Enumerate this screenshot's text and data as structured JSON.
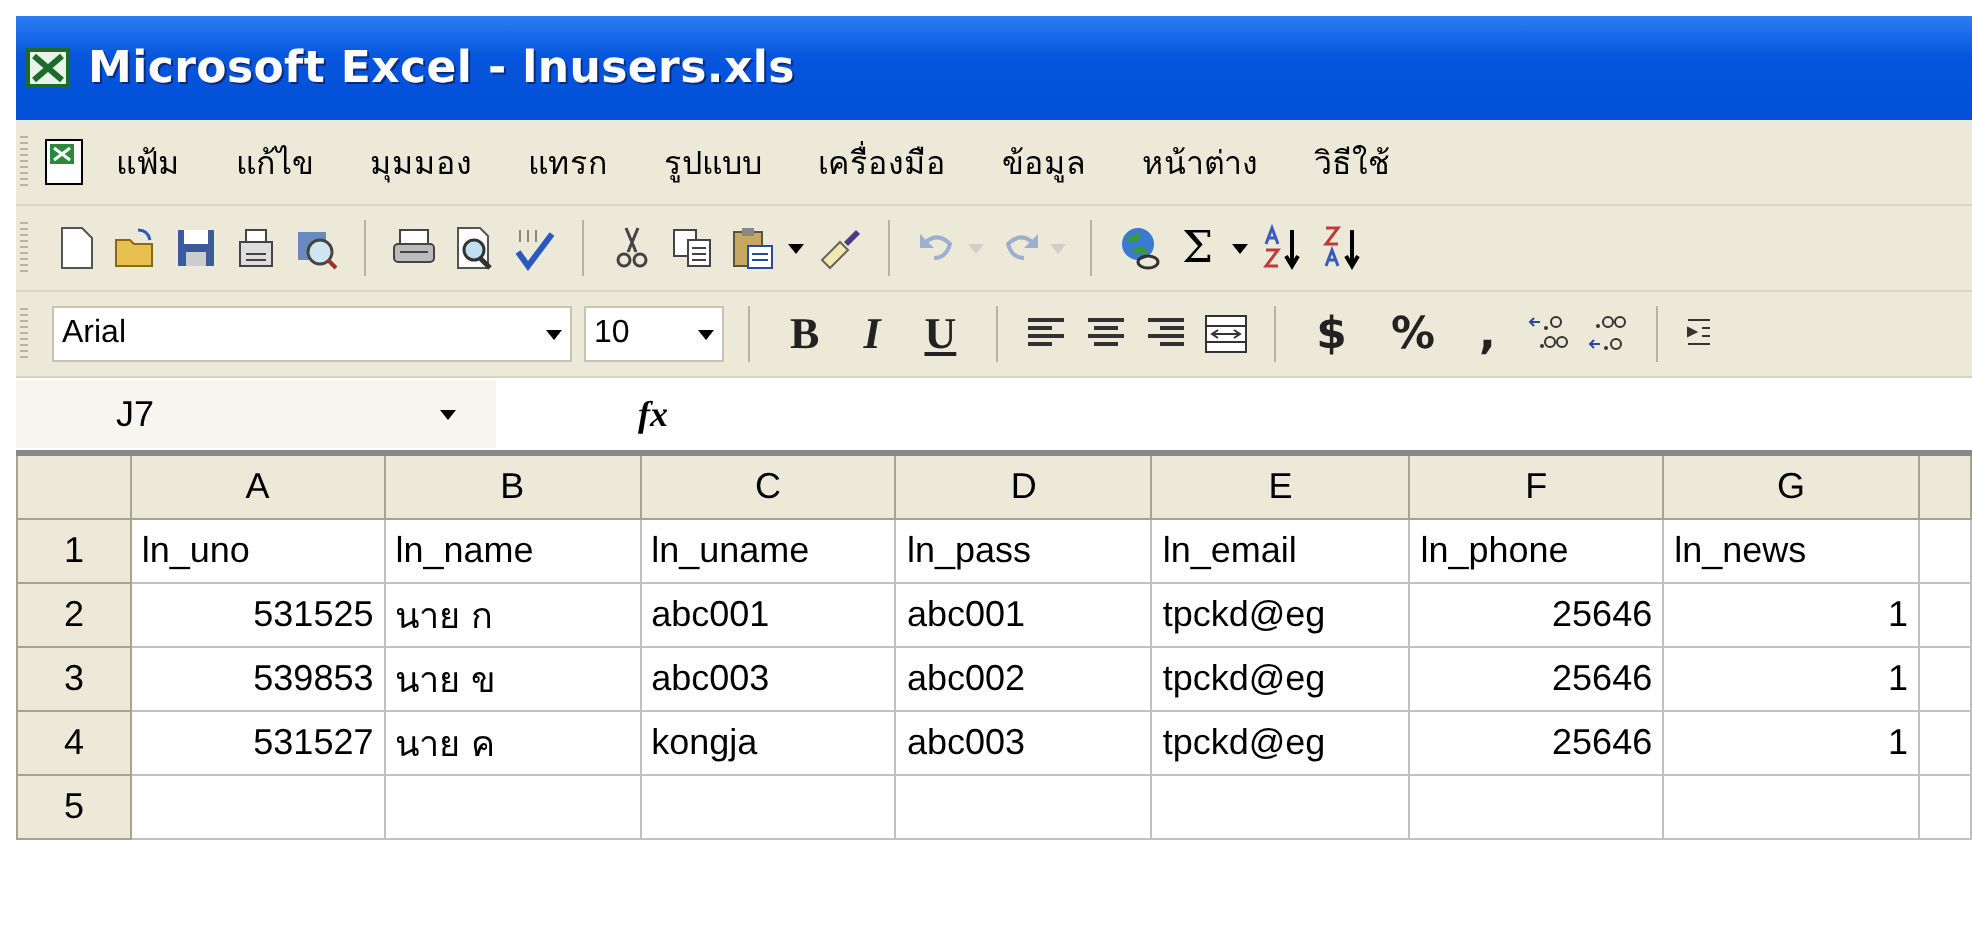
{
  "window": {
    "title": "Microsoft Excel - lnusers.xls"
  },
  "menu": [
    {
      "label": "แฟ้ม"
    },
    {
      "label": "แก้ไข"
    },
    {
      "label": "มุมมอง"
    },
    {
      "label": "แทรก"
    },
    {
      "label": "รูปแบบ"
    },
    {
      "label": "เครื่องมือ"
    },
    {
      "label": "ข้อมูล"
    },
    {
      "label": "หน้าต่าง"
    },
    {
      "label": "วิธีใช้"
    }
  ],
  "standard_toolbar": {
    "undo": {
      "disabled": true
    },
    "redo": {
      "disabled": true
    },
    "autosum": "Σ"
  },
  "formatting_toolbar": {
    "font": "Arial",
    "size": "10",
    "style_buttons": [
      "B",
      "I",
      "U"
    ],
    "number_buttons": [
      "$",
      "%",
      ","
    ]
  },
  "formula_bar": {
    "name_box": "J7",
    "function_label": "fx"
  },
  "sheet": {
    "columns": [
      "A",
      "B",
      "C",
      "D",
      "E",
      "F",
      "G"
    ],
    "rows": [
      {
        "number": "1",
        "cells": [
          {
            "text": "ln_uno",
            "kind": "text"
          },
          {
            "text": "ln_name",
            "kind": "text"
          },
          {
            "text": "ln_uname",
            "kind": "text"
          },
          {
            "text": "ln_pass",
            "kind": "text"
          },
          {
            "text": "ln_email",
            "kind": "text"
          },
          {
            "text": "ln_phone",
            "kind": "text"
          },
          {
            "text": "ln_news",
            "kind": "text"
          }
        ]
      },
      {
        "number": "2",
        "cells": [
          {
            "text": "531525",
            "kind": "number"
          },
          {
            "text": "นาย ก",
            "kind": "text"
          },
          {
            "text": "abc001",
            "kind": "text"
          },
          {
            "text": "abc001",
            "kind": "text"
          },
          {
            "text": "tpckd@eg",
            "kind": "text"
          },
          {
            "text": "25646",
            "kind": "number"
          },
          {
            "text": "1",
            "kind": "number"
          }
        ]
      },
      {
        "number": "3",
        "cells": [
          {
            "text": "539853",
            "kind": "number"
          },
          {
            "text": "นาย ข",
            "kind": "text"
          },
          {
            "text": "abc003",
            "kind": "text"
          },
          {
            "text": "abc002",
            "kind": "text"
          },
          {
            "text": "tpckd@eg",
            "kind": "text"
          },
          {
            "text": "25646",
            "kind": "number"
          },
          {
            "text": "1",
            "kind": "number"
          }
        ]
      },
      {
        "number": "4",
        "cells": [
          {
            "text": "531527",
            "kind": "number"
          },
          {
            "text": "นาย ค",
            "kind": "text"
          },
          {
            "text": "kongja",
            "kind": "text"
          },
          {
            "text": "abc003",
            "kind": "text"
          },
          {
            "text": "tpckd@eg",
            "kind": "text"
          },
          {
            "text": "25646",
            "kind": "number"
          },
          {
            "text": "1",
            "kind": "number"
          }
        ]
      },
      {
        "number": "5"
      }
    ]
  }
}
